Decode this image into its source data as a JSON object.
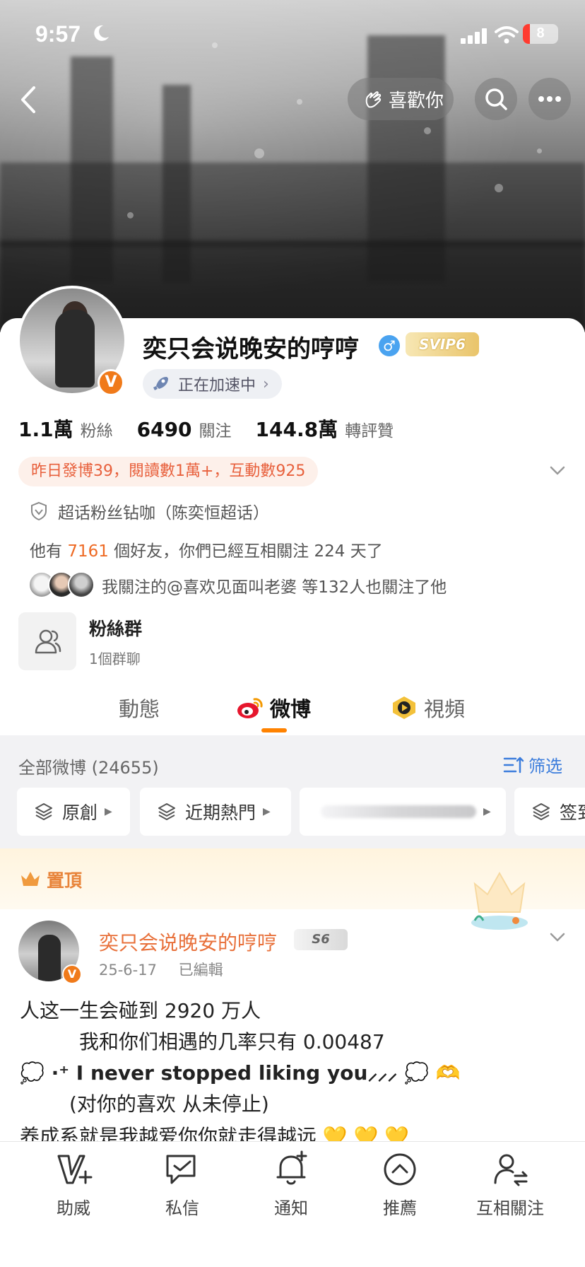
{
  "status_bar": {
    "time": "9:57",
    "battery": "8"
  },
  "header": {
    "like_button": "喜歡你"
  },
  "profile": {
    "name": "奕只会说晚安的哼哼",
    "svip_badge": "SVIP6",
    "boost_status": "正在加速中",
    "stats": [
      {
        "value": "1.1萬",
        "label": "粉絲"
      },
      {
        "value": "6490",
        "label": "關注"
      },
      {
        "value": "144.8萬",
        "label": "轉評贊"
      }
    ],
    "yesterday_summary": "昨日發博39，閱讀數1萬+，互動數925",
    "super_topic": "超话粉丝钻咖（陈奕恒超话）",
    "friends": {
      "prefix": "他有",
      "count": "7161",
      "suffix": "個好友，你們已經互相關注 224 天了"
    },
    "mutual_follow": "我關注的@喜欢见面叫老婆 等132人也關注了他",
    "fans_group": {
      "title": "粉絲群",
      "subtitle": "1個群聊"
    }
  },
  "tabs": [
    {
      "label": "動態",
      "active": false
    },
    {
      "label": "微博",
      "active": true
    },
    {
      "label": "視頻",
      "active": false
    }
  ],
  "filter": {
    "all_weibo": "全部微博 (24655)",
    "filter_label": "筛选",
    "chips": [
      "原創",
      "近期熱門",
      "",
      "签到"
    ]
  },
  "pinned": {
    "label": "置頂"
  },
  "post": {
    "author": "奕只会说晚安的哼哼",
    "badge": "S6",
    "date": "25-6-17",
    "edited": "已編輯",
    "lines": [
      "人这一生会碰到 2920 万人",
      "我和你们相遇的几率只有 0.00487",
      "💭 ·⁺ I never stopped liking you⸝⸝⸝ 💭 🫶",
      "(对你的喜欢 从未停止)",
      "养成系就是我越爱你你就走得越远 💛 💛 💛"
    ]
  },
  "bottom_nav": [
    {
      "label": "助威",
      "icon": "v-plus-icon"
    },
    {
      "label": "私信",
      "icon": "chat-icon"
    },
    {
      "label": "通知",
      "icon": "bell-icon"
    },
    {
      "label": "推薦",
      "icon": "up-arrow-circle-icon"
    },
    {
      "label": "互相關注",
      "icon": "mutual-follow-icon"
    }
  ],
  "colors": {
    "accent": "#ff8200",
    "orange_text": "#e8703a",
    "link_blue": "#3c7ddc"
  }
}
